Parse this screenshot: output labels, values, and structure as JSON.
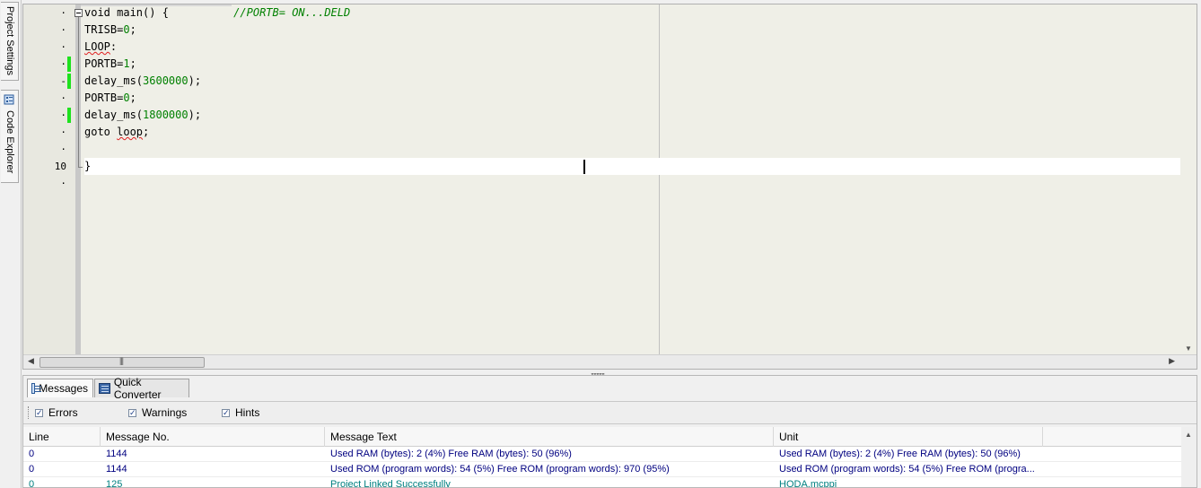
{
  "side_tabs": [
    {
      "label": "Project Settings"
    },
    {
      "label": "Code Explorer"
    }
  ],
  "editor": {
    "line_numbers": [
      "·",
      "·",
      "·",
      "·",
      "-",
      "·",
      "·",
      "·",
      "·",
      "10",
      "·"
    ],
    "lines": {
      "l1_kw": "void main() {",
      "l1_comment": "//PORTB= ON...DELD",
      "l2_a": "TRISB=",
      "l2_n": "0",
      "l2_b": ";",
      "l3": "LOOP",
      "l3_colon": ":",
      "l4_a": "PORTB=",
      "l4_n": "1",
      "l4_b": ";",
      "l5_a": "delay_ms(",
      "l5_n": "3600000",
      "l5_b": ");",
      "l6_a": "PORTB=",
      "l6_n": "0",
      "l6_b": ";",
      "l7_a": "delay_ms(",
      "l7_n": "1800000",
      "l7_b": ");",
      "l8_a": "goto ",
      "l8_label": "loop",
      "l8_b": ";",
      "l10": "}"
    }
  },
  "messages_panel": {
    "tabs": [
      {
        "label": "Messages",
        "icon": "messages-icon"
      },
      {
        "label": "Quick Converter",
        "icon": "calculator-icon"
      }
    ],
    "filters": [
      {
        "label": "Errors",
        "checked": true
      },
      {
        "label": "Warnings",
        "checked": true
      },
      {
        "label": "Hints",
        "checked": true
      }
    ],
    "columns": [
      "Line",
      "Message No.",
      "Message Text",
      "Unit"
    ],
    "rows": [
      {
        "line": "0",
        "msg_no": "1144",
        "text": "Used RAM (bytes): 2 (4%)  Free RAM (bytes): 50 (96%)",
        "unit": "Used RAM (bytes): 2 (4%)  Free RAM (bytes): 50 (96%)"
      },
      {
        "line": "0",
        "msg_no": "1144",
        "text": "Used ROM (program words): 54 (5%)  Free ROM (program words): 970 (95%)",
        "unit": "Used ROM (program words): 54 (5%)  Free ROM (progra..."
      },
      {
        "line": "0",
        "msg_no": "125",
        "text": "Project Linked Successfully",
        "unit": "HODA.mcppi"
      }
    ]
  },
  "colors": {
    "editor_bg": "#efefe7",
    "numeric_literal": "#008000",
    "comment": "#008000",
    "changed_marker": "#1ee11e",
    "message_text": "#000080",
    "info_text": "#008080"
  }
}
